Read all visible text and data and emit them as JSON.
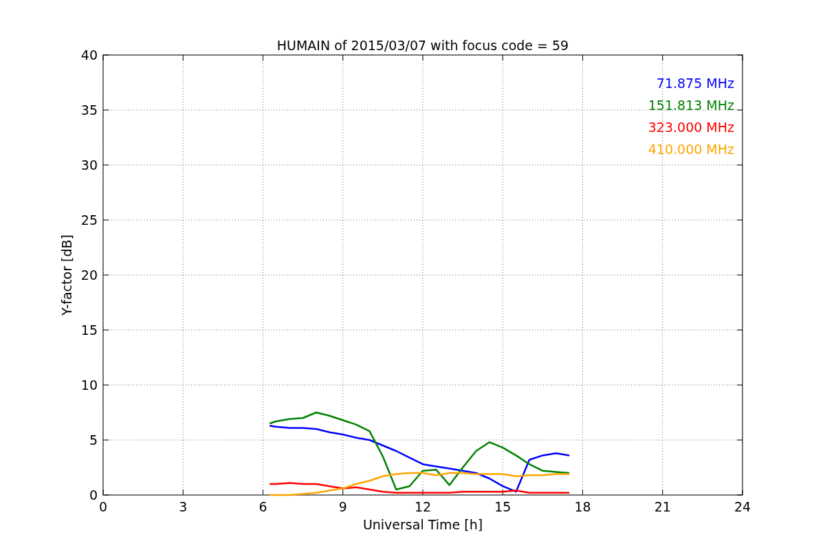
{
  "chart_data": {
    "type": "line",
    "title": "HUMAIN of 2015/03/07 with focus code = 59",
    "xlabel": "Universal Time [h]",
    "ylabel": "Y-factor [dB]",
    "x": [
      6.25,
      6.5,
      7,
      7.5,
      8,
      8.5,
      9,
      9.5,
      10,
      10.5,
      11,
      11.5,
      12,
      12.5,
      13,
      13.5,
      14,
      14.5,
      15,
      15.5,
      16,
      16.5,
      17,
      17.5
    ],
    "series": [
      {
        "name": "71.875 MHz",
        "color": "#0000ff",
        "values": [
          6.3,
          6.2,
          6.1,
          6.1,
          6.0,
          5.7,
          5.5,
          5.2,
          5.0,
          4.5,
          4.0,
          3.4,
          2.8,
          2.6,
          2.4,
          2.2,
          2.0,
          1.5,
          0.8,
          0.3,
          3.2,
          3.6,
          3.8,
          3.6
        ]
      },
      {
        "name": "151.813 MHz",
        "color": "#008000",
        "values": [
          6.5,
          6.7,
          6.9,
          7.0,
          7.5,
          7.2,
          6.8,
          6.4,
          5.8,
          3.5,
          0.5,
          0.8,
          2.2,
          2.3,
          0.9,
          2.5,
          4.0,
          4.8,
          4.3,
          3.6,
          2.8,
          2.2,
          2.1,
          2.0
        ]
      },
      {
        "name": "323.000 MHz",
        "color": "#ff0000",
        "values": [
          1.0,
          1.0,
          1.1,
          1.0,
          1.0,
          0.8,
          0.6,
          0.7,
          0.5,
          0.3,
          0.2,
          0.2,
          0.2,
          0.2,
          0.2,
          0.3,
          0.3,
          0.3,
          0.3,
          0.4,
          0.2,
          0.2,
          0.2,
          0.2
        ]
      },
      {
        "name": "410.000 MHz",
        "color": "#ffa500",
        "values": [
          0,
          0,
          0,
          0.1,
          0.2,
          0.4,
          0.6,
          1.0,
          1.3,
          1.7,
          1.9,
          2.0,
          2.0,
          1.8,
          2.0,
          2.0,
          1.9,
          1.9,
          1.9,
          1.7,
          1.8,
          1.8,
          1.9,
          1.9
        ]
      }
    ],
    "xlim": [
      0,
      24
    ],
    "ylim": [
      0,
      40
    ],
    "xticks": [
      0,
      3,
      6,
      9,
      12,
      15,
      18,
      21,
      24
    ],
    "yticks": [
      0,
      5,
      10,
      15,
      20,
      25,
      30,
      35,
      40
    ],
    "grid": true
  }
}
